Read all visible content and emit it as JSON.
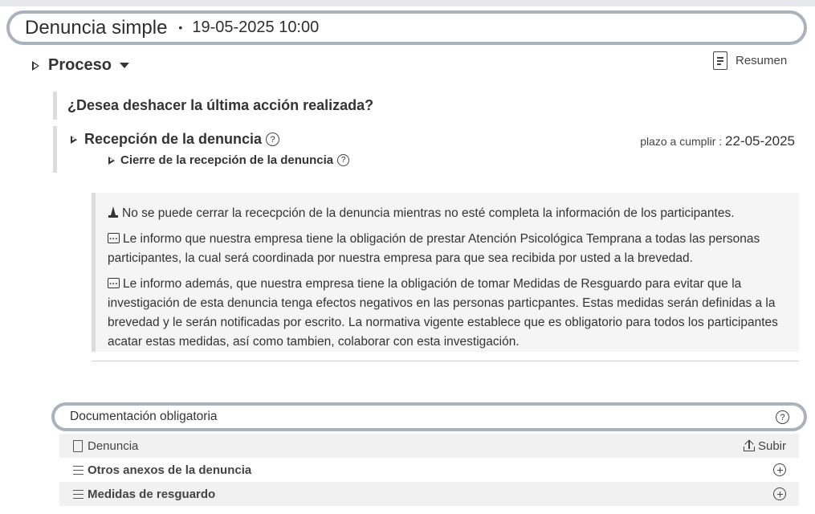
{
  "header": {
    "title": "Denuncia simple",
    "separator": "•",
    "datetime": "19-05-2025 10:00"
  },
  "proceso": {
    "label": "Proceso",
    "resumen_label": "Resumen"
  },
  "undo_prompt": "¿Desea deshacer la última acción realizada?",
  "recepcion": {
    "title": "Recepción de la denuncia",
    "help": "?",
    "plazo_label": "plazo a cumplir : ",
    "plazo_value": "22-05-2025",
    "sub_title": "Cierre de la recepción de la denuncia",
    "sub_help": "?"
  },
  "notes": [
    {
      "icon": "warning-cone-icon",
      "text": "No se puede cerrar la rececpción de la denuncia mientras no esté completa la información de los participantes."
    },
    {
      "icon": "message-icon",
      "text": "Le informo que nuestra empresa tiene la obligación de prestar Atención Psicológica Temprana a todas las personas participantes, la cual será coordinada por nuestra empresa para que sea recibida por usted a la brevedad."
    },
    {
      "icon": "message-icon",
      "text": "Le informo además, que nuestra empresa tiene la obligación de tomar Medidas de Resguardo para evitar que la investigación de esta denuncia tenga efectos negativos en las personas particpantes. Estas medidas serán definidas a la brevedad y le serán notificadas por escrito. La normativa vigente establece que es obligatorio para todos los participantes acatar estas medidas, así como tambien, colaborar con esta investigación."
    }
  ],
  "documentacion": {
    "title": "Documentación obligatoria",
    "help": "?",
    "rows": [
      {
        "label": "Denuncia",
        "action": "Subir"
      },
      {
        "label": "Otros anexos de la denuncia"
      },
      {
        "label": "Medidas de resguardo"
      }
    ]
  }
}
